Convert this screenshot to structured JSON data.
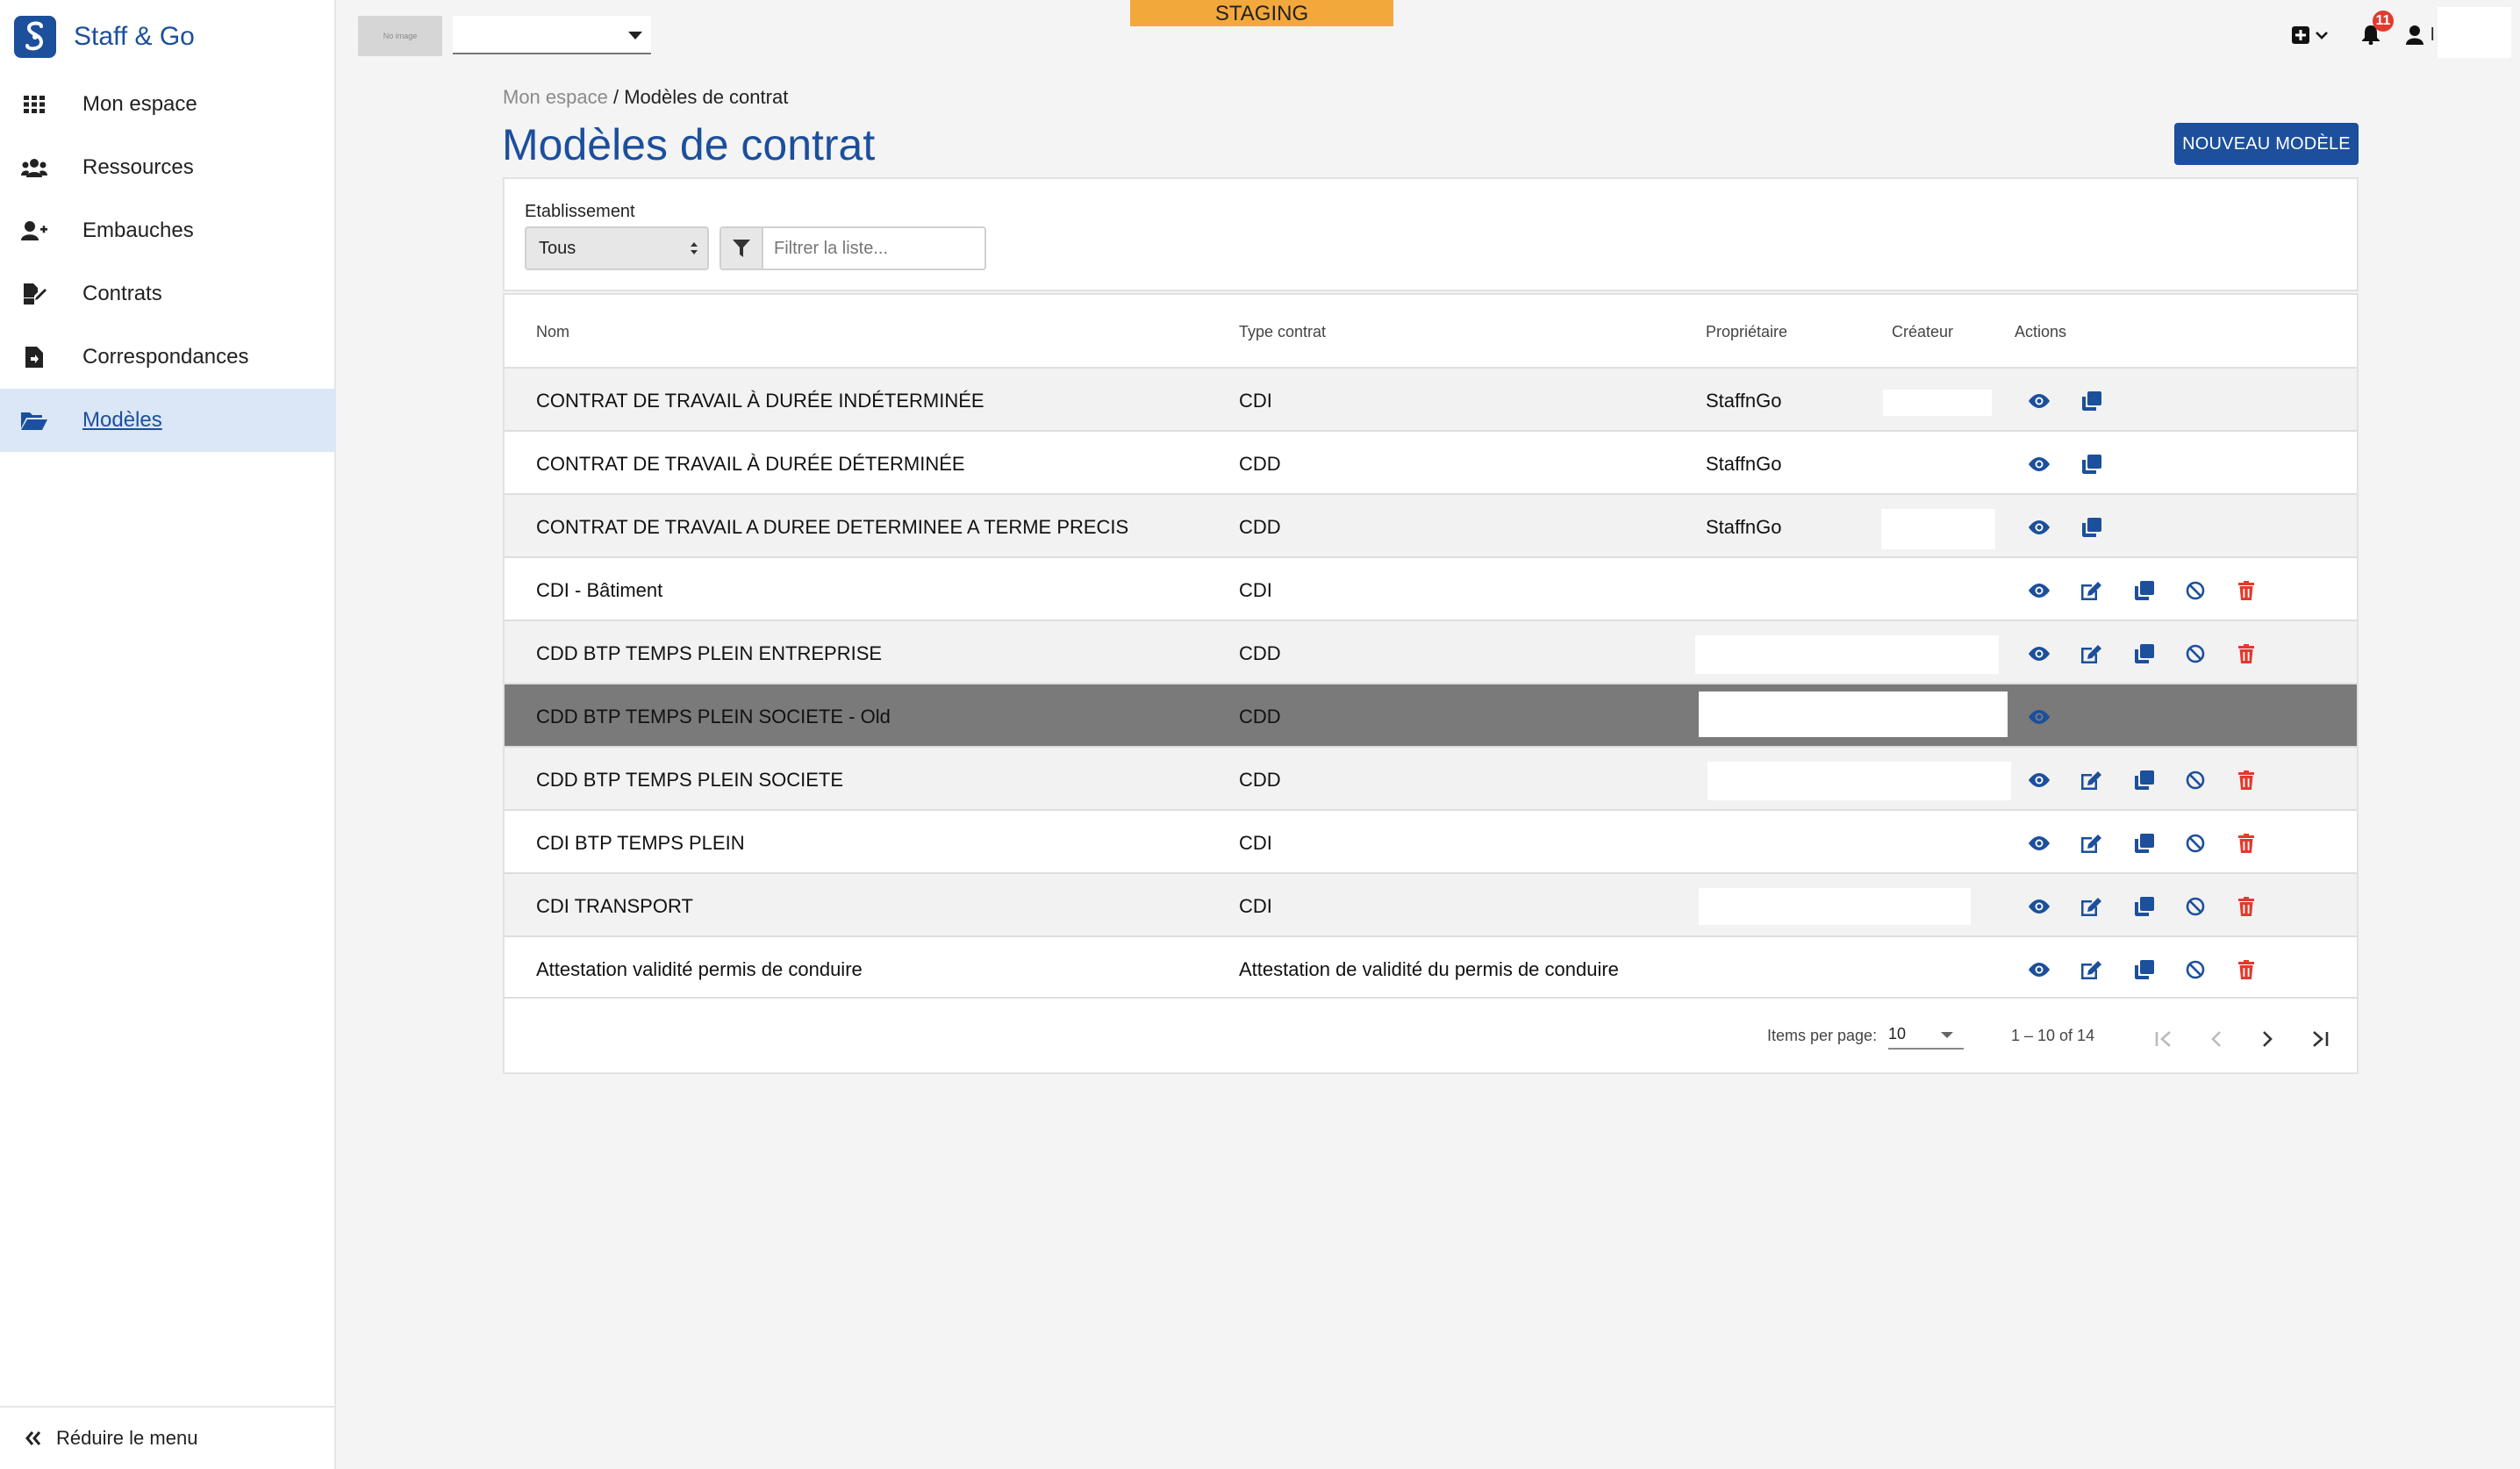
{
  "brand": {
    "name": "Staff & Go"
  },
  "sidebar": {
    "items": [
      {
        "label": "Mon espace",
        "icon": "grid-icon"
      },
      {
        "label": "Ressources",
        "icon": "users-icon"
      },
      {
        "label": "Embauches",
        "icon": "user-plus-icon"
      },
      {
        "label": "Contrats",
        "icon": "file-signature-icon"
      },
      {
        "label": "Correspondances",
        "icon": "file-arrow-icon"
      },
      {
        "label": "Modèles",
        "icon": "folder-open-icon",
        "active": true
      }
    ],
    "collapse_label": "Réduire le menu"
  },
  "topbar": {
    "logo_placeholder": "No image",
    "environment": "STAGING",
    "notifications_count": "11",
    "user_initial": "l"
  },
  "breadcrumb": {
    "parent": "Mon espace",
    "separator": " / ",
    "current": "Modèles de contrat"
  },
  "page": {
    "title": "Modèles de contrat",
    "new_button": "NOUVEAU MODÈLE"
  },
  "filters": {
    "etablissement_label": "Etablissement",
    "etablissement_value": "Tous",
    "search_placeholder": "Filtrer la liste..."
  },
  "table": {
    "columns": {
      "nom": "Nom",
      "type": "Type contrat",
      "owner": "Propriétaire",
      "creator": "Créateur",
      "actions": "Actions"
    },
    "rows": [
      {
        "nom": "CONTRAT DE TRAVAIL À DURÉE INDÉTERMINÉE",
        "type": "CDI",
        "owner": "StaffnGo",
        "actions": [
          "view",
          "copy"
        ]
      },
      {
        "nom": "CONTRAT DE TRAVAIL À DURÉE DÉTERMINÉE",
        "type": "CDD",
        "owner": "StaffnGo",
        "actions": [
          "view",
          "copy"
        ]
      },
      {
        "nom": "CONTRAT DE TRAVAIL A DUREE DETERMINEE A TERME PRECIS",
        "type": "CDD",
        "owner": "StaffnGo",
        "actions": [
          "view",
          "copy"
        ]
      },
      {
        "nom": "CDI - Bâtiment",
        "type": "CDI",
        "owner": "",
        "actions": [
          "view",
          "edit",
          "copy",
          "disable",
          "delete"
        ]
      },
      {
        "nom": "CDD BTP TEMPS PLEIN ENTREPRISE",
        "type": "CDD",
        "owner": "",
        "actions": [
          "view",
          "edit",
          "copy",
          "disable",
          "delete"
        ]
      },
      {
        "nom": "CDD BTP TEMPS PLEIN SOCIETE - Old",
        "type": "CDD",
        "owner": "",
        "actions": [
          "view"
        ],
        "disabled": true
      },
      {
        "nom": "CDD BTP TEMPS PLEIN SOCIETE",
        "type": "CDD",
        "owner": "",
        "actions": [
          "view",
          "edit",
          "copy",
          "disable",
          "delete"
        ]
      },
      {
        "nom": "CDI BTP TEMPS PLEIN",
        "type": "CDI",
        "owner": "",
        "actions": [
          "view",
          "edit",
          "copy",
          "disable",
          "delete"
        ]
      },
      {
        "nom": "CDI TRANSPORT",
        "type": "CDI",
        "owner": "",
        "actions": [
          "view",
          "edit",
          "copy",
          "disable",
          "delete"
        ]
      },
      {
        "nom": "Attestation validité permis de conduire",
        "type": "Attestation de validité du permis de conduire",
        "owner": "",
        "actions": [
          "view",
          "edit",
          "copy",
          "disable",
          "delete"
        ]
      }
    ]
  },
  "pagination": {
    "items_per_page_label": "Items per page:",
    "items_per_page": "10",
    "range": "1 – 10 of 14"
  },
  "colors": {
    "primary": "#1c4f9c",
    "staging": "#f3a83b",
    "danger": "#e03b2e",
    "selected_row": "#7a7a7a",
    "active_nav": "#dbe7f6"
  }
}
